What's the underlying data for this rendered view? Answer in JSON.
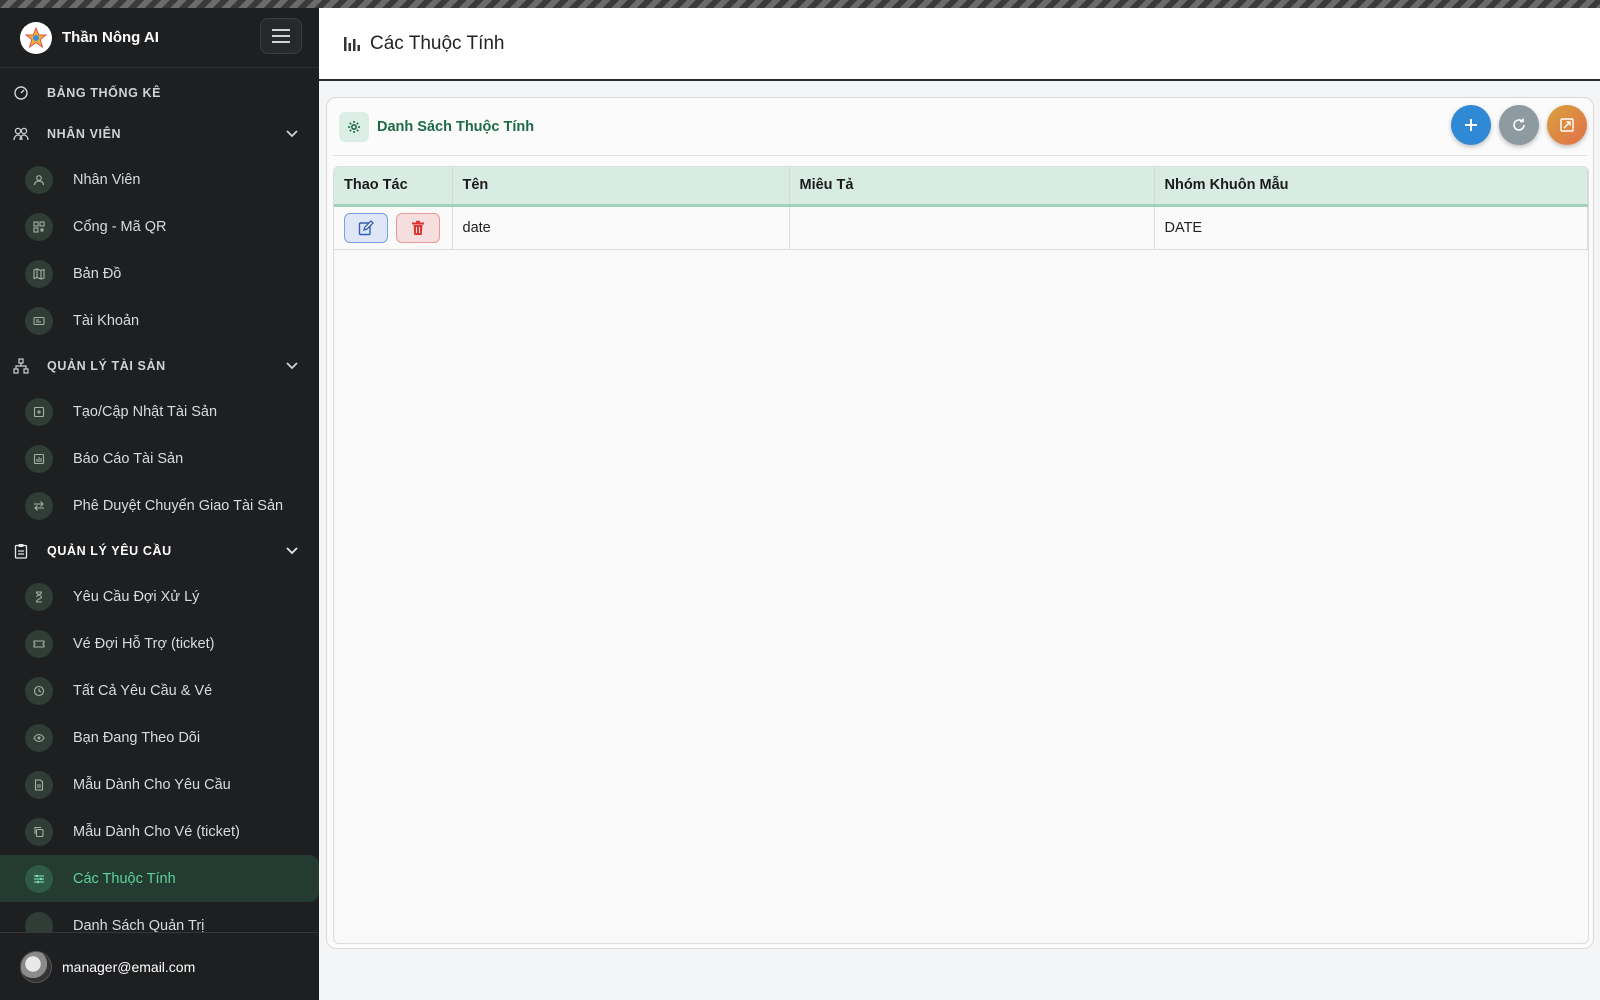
{
  "app": {
    "brand": "Thần Nông AI"
  },
  "header": {
    "title": "Các Thuộc Tính"
  },
  "sidebar": {
    "dashboard": "BẢNG THỐNG KÊ",
    "groups": [
      {
        "title": "NHÂN VIÊN",
        "items": [
          "Nhân Viên",
          "Cổng - Mã QR",
          "Bản Đồ",
          "Tài Khoản"
        ]
      },
      {
        "title": "QUẢN LÝ TÀI SẢN",
        "items": [
          "Tạo/Cập Nhật Tài Sản",
          "Báo Cáo Tài Sản",
          "Phê Duyệt Chuyển Giao Tài Sản"
        ]
      },
      {
        "title": "QUẢN LÝ YÊU CẦU",
        "items": [
          "Yêu Cầu Đợi Xử Lý",
          "Vé Đợi Hỗ Trợ (ticket)",
          "Tất Cả Yêu Cầu & Vé",
          "Bạn Đang Theo Dõi",
          "Mẫu Dành Cho Yêu Cầu",
          "Mẫu Dành Cho Vé (ticket)",
          "Các Thuộc Tính",
          "Danh Sách Quản Trị"
        ]
      }
    ],
    "selected_item": "Các Thuộc Tính",
    "footer_email": "manager@email.com"
  },
  "card": {
    "title": "Danh Sách Thuộc Tính",
    "buttons": {
      "add": "plus-icon",
      "refresh": "refresh-icon",
      "expand": "expand-icon"
    }
  },
  "table": {
    "columns": [
      "Thao Tác",
      "Tên",
      "Miêu Tả",
      "Nhóm Khuôn Mẫu"
    ],
    "rows": [
      {
        "name": "date",
        "description": "",
        "group": "DATE"
      }
    ]
  },
  "colors": {
    "accent": "#1d6a48",
    "sidebar_bg": "#1e1f21",
    "selected_text": "#5fd39b",
    "add_button": "#2f89d4"
  }
}
